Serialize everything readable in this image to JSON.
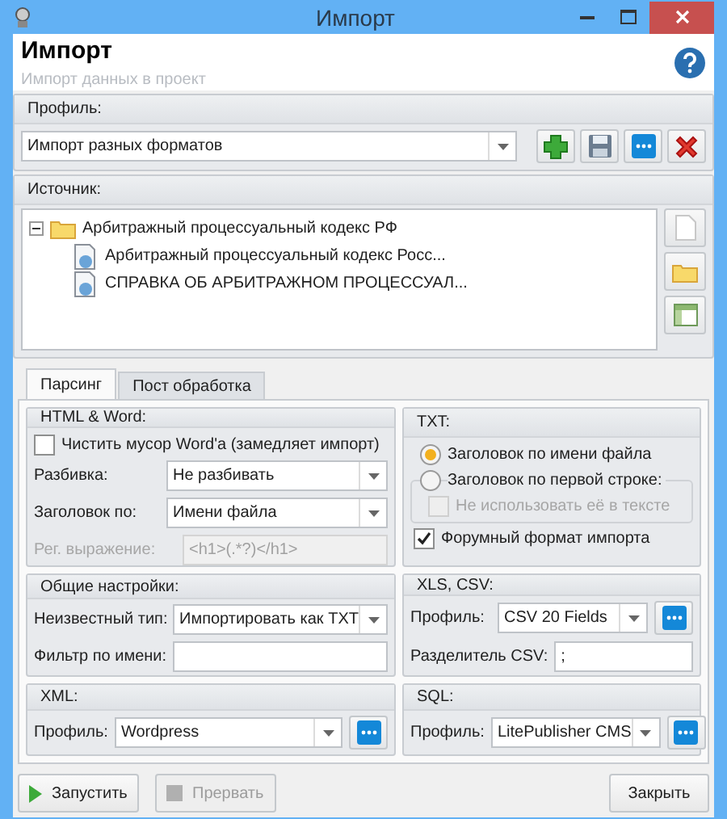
{
  "window": {
    "title": "Импорт"
  },
  "header": {
    "title": "Импорт",
    "subtitle": "Импорт данных в проект"
  },
  "profile": {
    "label": "Профиль:",
    "value": "Импорт разных форматов",
    "buttons": [
      {
        "kind": "add"
      },
      {
        "kind": "save"
      },
      {
        "kind": "more"
      },
      {
        "kind": "delete"
      }
    ]
  },
  "source": {
    "label": "Источник:",
    "tree": [
      {
        "label": "Арбитражный процессуальный кодекс РФ",
        "kind": "folder",
        "expanded": true,
        "children": [
          {
            "label": "Арбитражный процессуальный кодекс Росс...",
            "kind": "document"
          },
          {
            "label": "СПРАВКА ОБ АРБИТРАЖНОМ ПРОЦЕССУАЛ...",
            "kind": "document"
          }
        ]
      }
    ],
    "buttons": [
      {
        "kind": "file"
      },
      {
        "kind": "folder"
      },
      {
        "kind": "table"
      }
    ]
  },
  "tabs": [
    {
      "label": "Парсинг",
      "selected": true
    },
    {
      "label": "Пост обработка",
      "selected": false
    }
  ],
  "html_word": {
    "title": "HTML & Word:",
    "clean_word": {
      "label": "Чистить мусор Word'a (замедляет импорт)",
      "checked": false
    },
    "split": {
      "label": "Разбивка:",
      "value": "Не разбивать"
    },
    "heading": {
      "label": "Заголовок по:",
      "value": "Имени файла"
    },
    "regex": {
      "label": "Рег. выражение:",
      "value": "<h1>(.*?)</h1>",
      "disabled": true
    }
  },
  "txt": {
    "title": "TXT:",
    "radios": [
      {
        "label": "Заголовок по имени файла",
        "selected": true
      },
      {
        "label": "Заголовок по первой строке:",
        "selected": false
      }
    ],
    "not_use": {
      "label": "Не использовать её в тексте",
      "checked": false,
      "disabled": true
    },
    "forum": {
      "label": "Форумный формат импорта",
      "checked": true
    }
  },
  "general": {
    "title": "Общие настройки:",
    "unknown_type": {
      "label": "Неизвестный тип:",
      "value": "Импортировать как TXT"
    },
    "name_filter": {
      "label": "Фильтр по имени:"
    }
  },
  "xls_csv": {
    "title": "XLS, CSV:",
    "profile": {
      "label": "Профиль:",
      "value": "CSV 20 Fields"
    },
    "separator": {
      "label": "Разделитель CSV:",
      "value": ";"
    }
  },
  "xml": {
    "title": "XML:",
    "profile": {
      "label": "Профиль:",
      "value": "Wordpress"
    }
  },
  "sql": {
    "title": "SQL:",
    "profile": {
      "label": "Профиль:",
      "value": "LitePublisher CMS"
    }
  },
  "footer": [
    {
      "label": "Запустить",
      "kind": "run",
      "disabled": false
    },
    {
      "label": "Прервать",
      "kind": "stop",
      "disabled": true
    },
    {
      "label": "Закрыть",
      "kind": "close",
      "disabled": false
    }
  ]
}
